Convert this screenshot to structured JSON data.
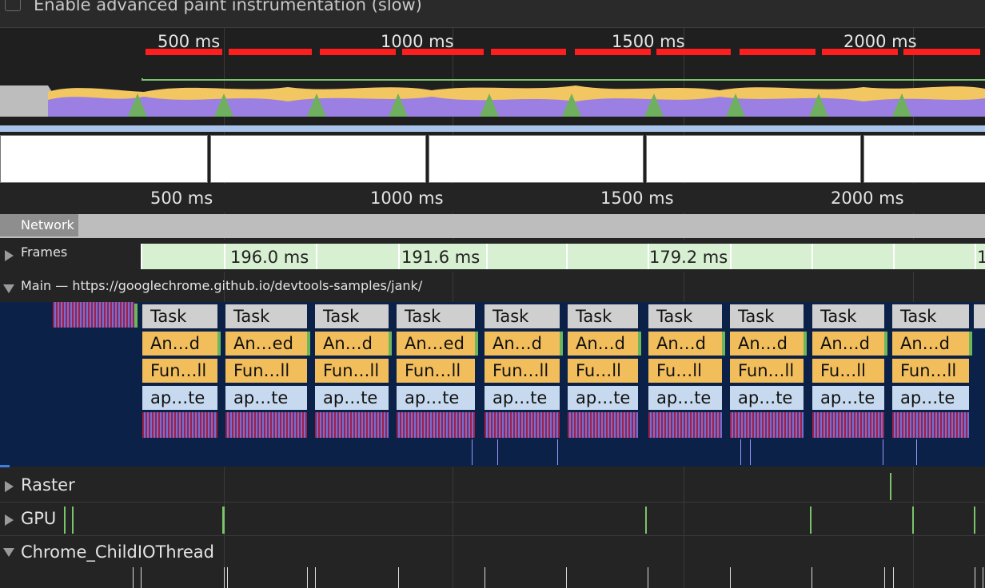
{
  "settings": {
    "paint_instrumentation_label": "Enable advanced paint instrumentation (slow)"
  },
  "overview": {
    "tick_labels": [
      "500 ms",
      "1000 ms",
      "1500 ms",
      "2000 ms"
    ],
    "colors": {
      "fps_red": "#ff1e1e",
      "scripting": "#9c7fe3",
      "rendering": "#f2c661",
      "painting": "#6eb05f",
      "network": "#a9c4ea"
    }
  },
  "ruler": {
    "tick_labels": [
      "500 ms",
      "1000 ms",
      "1500 ms",
      "2000 ms"
    ]
  },
  "tracks": {
    "network": "Network",
    "frames": "Frames",
    "frame_durations": [
      "196.0 ms",
      "191.6 ms",
      "179.2 ms",
      "1"
    ],
    "main": "Main — https://googlechrome.github.io/devtools-samples/jank/",
    "raster": "Raster",
    "gpu": "GPU",
    "io_thread": "Chrome_ChildIOThread"
  },
  "main_flame": {
    "task_label": "Task",
    "columns": [
      {
        "anim": "An…d",
        "fun": "Fun…ll",
        "ap": "ap…te"
      },
      {
        "anim": "An…ed",
        "fun": "Fun…ll",
        "ap": "ap…te"
      },
      {
        "anim": "An…d",
        "fun": "Fun…ll",
        "ap": "ap…te"
      },
      {
        "anim": "An…ed",
        "fun": "Fun…ll",
        "ap": "ap…te"
      },
      {
        "anim": "An…d",
        "fun": "Fun…ll",
        "ap": "ap…te"
      },
      {
        "anim": "An…d",
        "fun": "Fu…ll",
        "ap": "ap…te"
      },
      {
        "anim": "An…d",
        "fun": "Fu…ll",
        "ap": "ap…te"
      },
      {
        "anim": "An…d",
        "fun": "Fun…ll",
        "ap": "ap…te"
      },
      {
        "anim": "An…d",
        "fun": "Fu…ll",
        "ap": "ap…te"
      },
      {
        "anim": "An…d",
        "fun": "Fun…ll",
        "ap": "ap…te"
      }
    ]
  }
}
